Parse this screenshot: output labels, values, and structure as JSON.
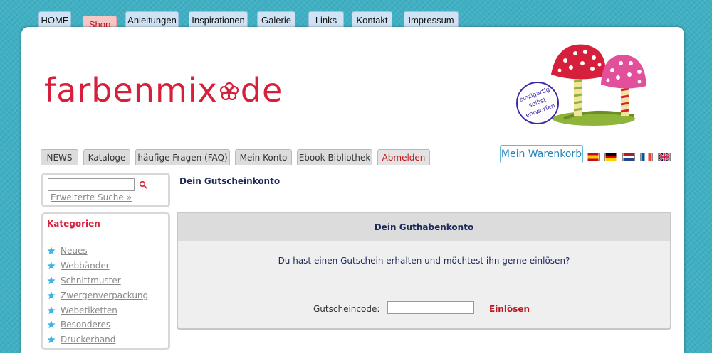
{
  "topnav": {
    "items": [
      {
        "label": "HOME"
      },
      {
        "label": "Shop"
      },
      {
        "label": "Anleitungen"
      },
      {
        "label": "Inspirationen"
      },
      {
        "label": "Galerie"
      },
      {
        "label": "Links"
      },
      {
        "label": "Kontakt"
      },
      {
        "label": "Impressum"
      }
    ]
  },
  "header": {
    "logo_text": "farbenmix",
    "logo_suffix": "de",
    "stamp_lines": [
      "einzigartig",
      "selbst",
      "entworfen"
    ]
  },
  "subnav": {
    "items": [
      {
        "label": "NEWS"
      },
      {
        "label": "Kataloge"
      },
      {
        "label": "häufige Fragen (FAQ)"
      },
      {
        "label": "Mein Konto"
      },
      {
        "label": "Ebook-Bibliothek"
      },
      {
        "label": "Abmelden"
      }
    ],
    "cart_label": "Mein Warenkorb",
    "flags": [
      "flag-es",
      "flag-de",
      "flag-nl",
      "flag-fr",
      "flag-gb"
    ]
  },
  "search": {
    "value": "",
    "advanced_label": "Erweiterte Suche »"
  },
  "categories": {
    "title": "Kategorien",
    "items": [
      {
        "label": "Neues"
      },
      {
        "label": "Webbänder"
      },
      {
        "label": "Schnittmuster"
      },
      {
        "label": "Zwergenverpackung"
      },
      {
        "label": "Webetiketten"
      },
      {
        "label": "Besonderes"
      },
      {
        "label": "Druckerband"
      }
    ]
  },
  "main": {
    "heading": "Dein Gutscheinkonto",
    "box_title": "Dein Guthabenkonto",
    "message": "Du hast einen Gutschein erhalten und möchtest ihn gerne einlösen?",
    "code_label": "Gutscheincode:",
    "code_value": "",
    "redeem_label": "Einlösen"
  },
  "colors": {
    "brand_red": "#d6203b",
    "accent_blue": "#6ab7da",
    "background_teal": "#3fb0c4"
  }
}
